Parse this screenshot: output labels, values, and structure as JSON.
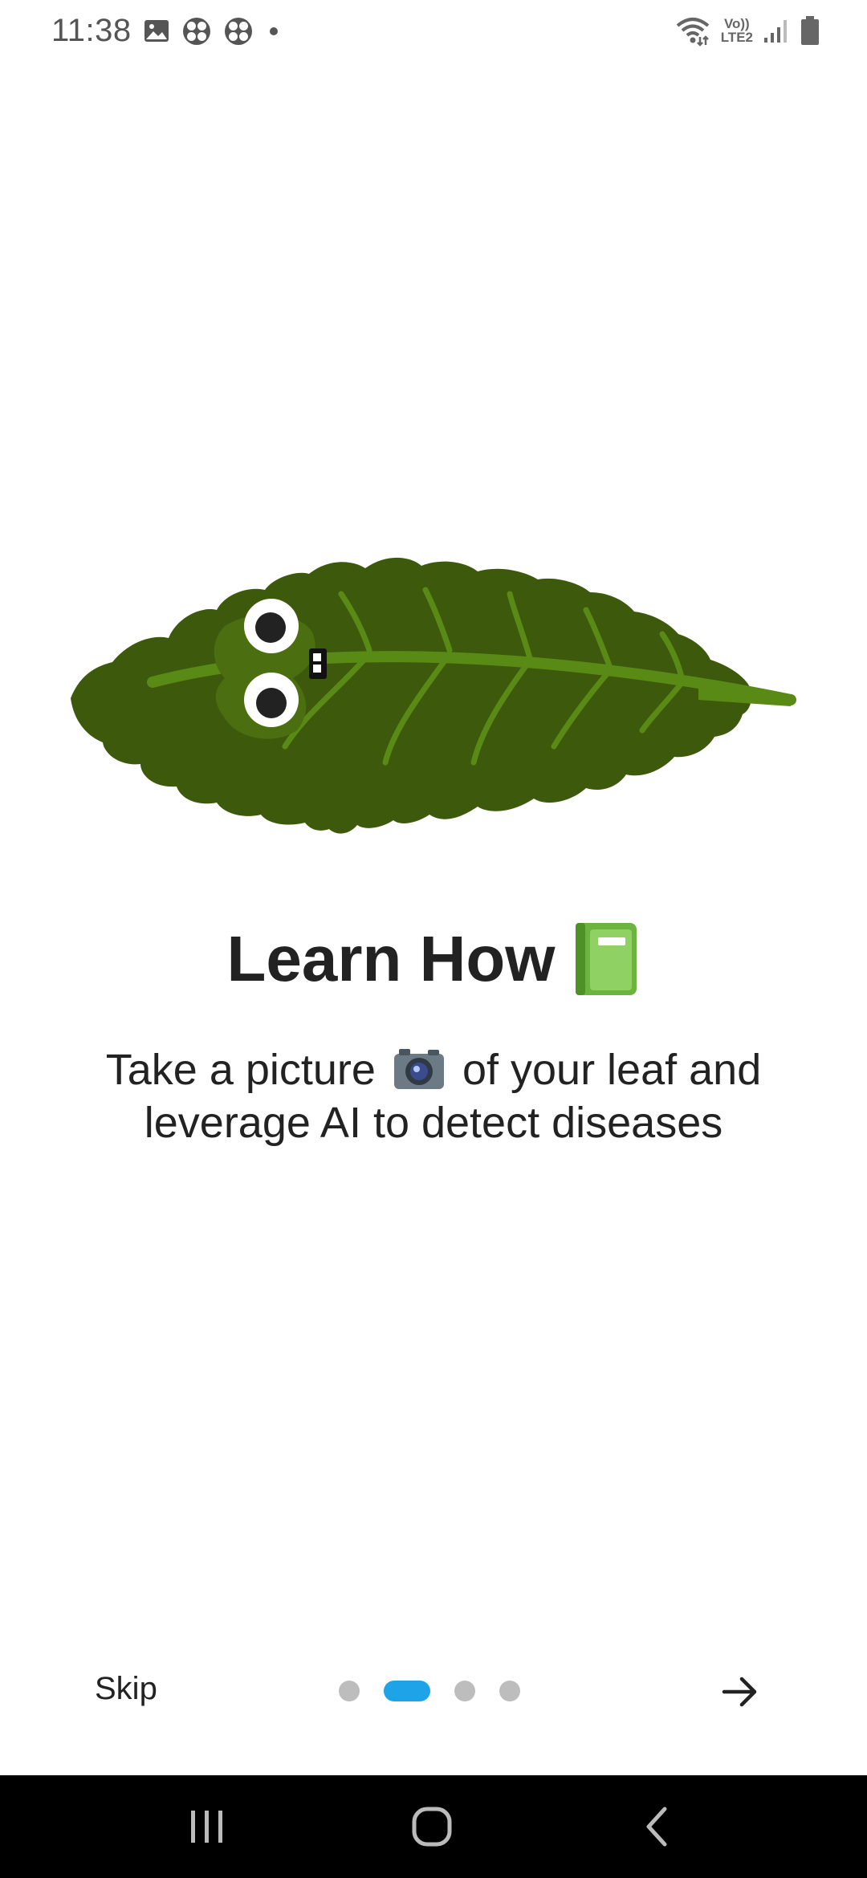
{
  "status_bar": {
    "time": "11:38",
    "volte_top": "Vo))",
    "volte_bottom": "LTE2",
    "icons": [
      "gallery-icon",
      "pinwheel-icon",
      "pinwheel-icon",
      "dot-icon",
      "wifi-icon",
      "signal-icon",
      "battery-icon"
    ]
  },
  "onboarding": {
    "title": "Learn How",
    "title_emoji": "book-icon",
    "subtitle_part1": "Take a picture",
    "subtitle_part2": "of your leaf and leverage AI to detect diseases",
    "subtitle_emoji": "camera-icon",
    "skip_label": "Skip",
    "page_index": 2,
    "page_count": 4
  },
  "colors": {
    "leaf_dark": "#3d5a0c",
    "leaf_vein": "#5a8a16",
    "dot_active": "#1ea3e8",
    "dot_inactive": "#bdbdbd",
    "nav_bg": "#000000"
  },
  "nav_bar": {
    "buttons": [
      "recent-apps-icon",
      "home-icon",
      "back-icon"
    ]
  }
}
